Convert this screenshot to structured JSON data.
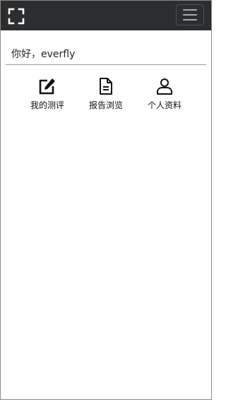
{
  "header": {
    "logo_icon": "expand-corners-icon",
    "menu_icon": "hamburger-icon",
    "background": "#2c2d2f"
  },
  "greeting": {
    "text": "你好，everfly"
  },
  "nav": {
    "items": [
      {
        "label": "我的测评",
        "icon": "edit-icon"
      },
      {
        "label": "报告浏览",
        "icon": "document-icon"
      },
      {
        "label": "个人资料",
        "icon": "user-icon"
      }
    ]
  }
}
